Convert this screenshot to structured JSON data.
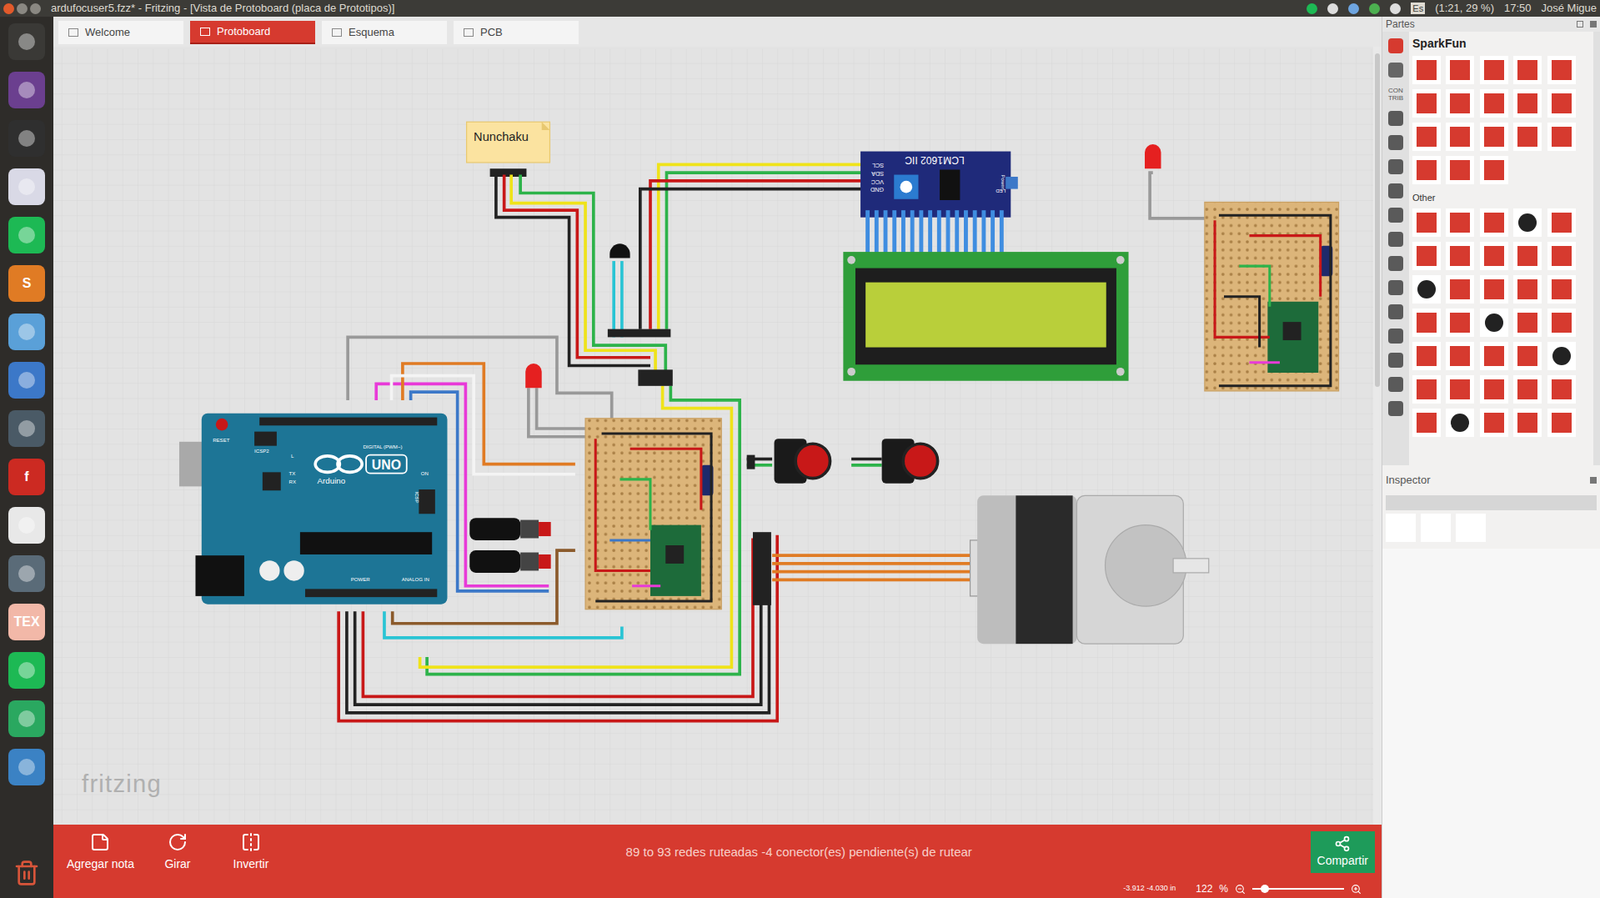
{
  "top_bar": {
    "title": "ardufocuser5.fzz* - Fritzing - [Vista de Protoboard (placa de Prototipos)]",
    "indicators": [
      "Es",
      "(1:21, 29 %)",
      "17:50",
      "José Migue"
    ]
  },
  "launcher": [
    {
      "color": "#3a3936"
    },
    {
      "color": "#6b3f8f"
    },
    {
      "color": "#2f2f2f"
    },
    {
      "color": "#d9d9e6"
    },
    {
      "color": "#1db954"
    },
    {
      "color": "#e07b24",
      "glyph": "S"
    },
    {
      "color": "#5aa0d8"
    },
    {
      "color": "#3c78c8"
    },
    {
      "color": "#4a5a66"
    },
    {
      "color": "#cc2a22",
      "glyph": "f"
    },
    {
      "color": "#e8e8e8"
    },
    {
      "color": "#5a6b78"
    },
    {
      "color": "#f2b8a8",
      "glyph": "TEX"
    },
    {
      "color": "#1db954"
    },
    {
      "color": "#2aa860"
    },
    {
      "color": "#3b82c4"
    }
  ],
  "tabs": [
    {
      "label": "Welcome",
      "selected": false
    },
    {
      "label": "Protoboard",
      "selected": true
    },
    {
      "label": "Esquema",
      "selected": false
    },
    {
      "label": "PCB",
      "selected": false
    }
  ],
  "canvas": {
    "note": "Nunchaku",
    "lcd_module": "LCM1602 IIC",
    "lcd_pins": [
      "SCL",
      "SDA",
      "VCC",
      "GND"
    ],
    "lcd_marks": [
      "Power",
      "LED"
    ],
    "arduino": {
      "brand": "Arduino",
      "model": "UNO",
      "reset": "RESET",
      "icsp2": "ICSP2",
      "led": "L",
      "tx": "TX",
      "rx": "RX",
      "digital": "DIGITAL (PWM~)",
      "icsp": "ICSP",
      "on": "ON",
      "power": "POWER",
      "analog": "ANALOG IN"
    },
    "watermark": "fritzing"
  },
  "toolbar": {
    "buttons": [
      "Agregar nota",
      "Girar",
      "Invertir"
    ],
    "status": "89 to 93 redes ruteadas -4 conector(es) pendiente(s) de rutear",
    "share": "Compartir"
  },
  "status_bar": {
    "coords": "-3.912 -4.030 in",
    "zoom": "122",
    "unit": "%"
  },
  "parts_panel": {
    "title": "Partes",
    "bin": "SparkFun",
    "section": "Other",
    "side_tab": [
      "CON",
      "TRIB"
    ]
  },
  "inspector": {
    "title": "Inspector"
  }
}
